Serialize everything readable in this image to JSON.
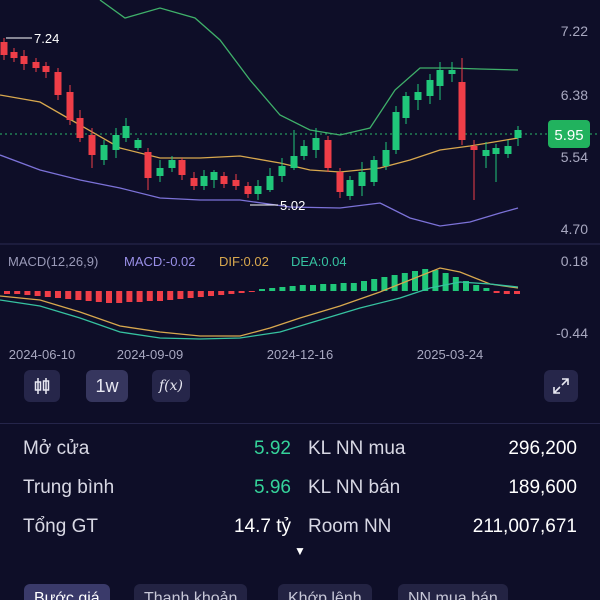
{
  "chart": {
    "price_ticks": [
      "7.22",
      "6.38",
      "5.54",
      "4.70"
    ],
    "current_price": "5.95",
    "high_label": "7.24",
    "low_label": "5.02",
    "macd_title": "MACD(12,26,9)",
    "macd_value": "MACD:-0.02",
    "dif_value": "DIF:0.02",
    "dea_value": "DEA:0.04",
    "macd_ticks": [
      "0.18",
      "-0.44"
    ],
    "dates": [
      "2024-06-10",
      "2024-09-09",
      "2024-12-16",
      "2025-03-24"
    ],
    "colors": {
      "up": "#20c77a",
      "down": "#ef3e48",
      "ma": "#d8a84e",
      "upper_band": "#3fb06a",
      "lower_band": "#7c72d8",
      "dif": "#d8a84e",
      "dea": "#36c2a0",
      "price_tag": "#21b25e"
    }
  },
  "toolbar": {
    "candle_icon": "candlestick-icon",
    "interval": "1w",
    "indicator_label": "f(x)",
    "expand_icon": "expand-icon"
  },
  "stats": {
    "open_label": "Mở cửa",
    "open_value": "5.92",
    "avg_label": "Trung bình",
    "avg_value": "5.96",
    "total_label": "Tổng GT",
    "total_value": "14.7 tỷ",
    "buy_label": "KL NN mua",
    "buy_value": "296,200",
    "sell_label": "KL NN bán",
    "sell_value": "189,600",
    "room_label": "Room NN",
    "room_value": "211,007,671"
  },
  "tabs": [
    "Bước giá",
    "Thanh khoản",
    "Khớp lệnh",
    "NN mua bán"
  ]
}
